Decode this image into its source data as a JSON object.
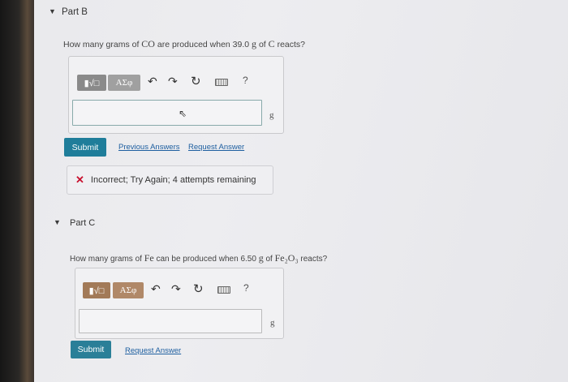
{
  "part_b": {
    "title": "Part B",
    "question_pre": "How many grams of ",
    "question_co": "CO",
    "question_mid": " are produced when 39.0 ",
    "question_g": "g",
    "question_of": " of ",
    "question_c": "C",
    "question_post": " reacts?",
    "toolbar": {
      "templates_label": "▮√□",
      "symbols_label": "ΑΣφ",
      "help_label": "?"
    },
    "answer_value": "",
    "unit": "g",
    "submit_label": "Submit",
    "previous_answers_label": "Previous Answers",
    "request_answer_label": "Request Answer",
    "feedback_label": "Incorrect; Try Again; 4 attempts remaining"
  },
  "part_c": {
    "title": "Part C",
    "question_pre": "How many grams of ",
    "question_fe": "Fe",
    "question_mid": " can be produced when 6.50 ",
    "question_g": "g",
    "question_of": " of ",
    "question_fe2o3": "Fe₂O₃",
    "question_post": " reacts?",
    "toolbar": {
      "templates_label": "▮√□",
      "symbols_label": "ΑΣφ",
      "help_label": "?"
    },
    "answer_value": "",
    "unit": "g",
    "submit_label": "Submit",
    "request_answer_label": "Request Answer"
  }
}
